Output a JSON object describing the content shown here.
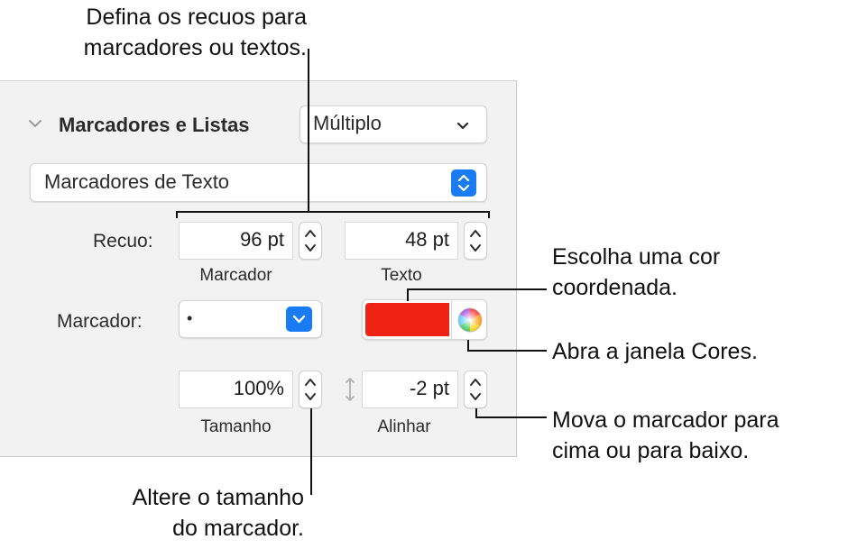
{
  "callouts": {
    "indents": "Defina os recuos para\nmarcadores ou textos.",
    "color": "Escolha uma cor\ncoordenada.",
    "color_window": "Abra a janela Cores.",
    "align": "Mova o marcador para\ncima ou para baixo.",
    "size": "Altere o tamanho\ndo marcador."
  },
  "panel": {
    "section_title": "Marcadores e Listas",
    "list_style_popup": "Múltiplo",
    "bullet_type_popup": "Marcadores de Texto",
    "indent_label": "Recuo:",
    "bullet_indent_value": "96 pt",
    "text_indent_value": "48 pt",
    "bullet_indent_caption": "Marcador",
    "text_indent_caption": "Texto",
    "bullet_label": "Marcador:",
    "bullet_char": "•",
    "bullet_color": "#ee2314",
    "size_value": "100%",
    "size_caption": "Tamanho",
    "align_value": "-2 pt",
    "align_caption": "Alinhar"
  }
}
